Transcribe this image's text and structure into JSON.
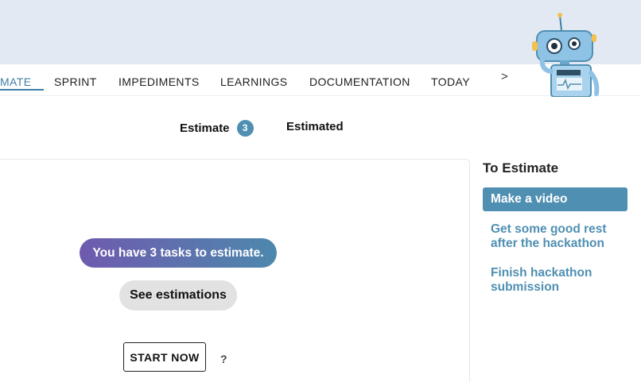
{
  "nav": {
    "items": [
      "MATE",
      "SPRINT",
      "IMPEDIMENTS",
      "LEARNINGS",
      "DOCUMENTATION",
      "TODAY"
    ],
    "active_index": 0,
    "next_glyph": ">"
  },
  "tabs": {
    "estimate_label": "Estimate",
    "estimate_count": "3",
    "estimated_label": "Estimated"
  },
  "main": {
    "info_text": "You have 3 tasks to estimate.",
    "see_button": "See estimations",
    "start_button": "START NOW",
    "help_glyph": "?"
  },
  "sidebar": {
    "title": "To Estimate",
    "items": [
      "Make a video",
      "Get some good rest after the hackathon",
      "Finish hackathon submission"
    ],
    "selected_index": 0
  },
  "colors": {
    "accent": "#4f8fb2",
    "header_bg": "#e3e9f2",
    "gradient_start": "#6f5aae",
    "gradient_end": "#4d88ad"
  },
  "icons": {
    "mascot": "robot-mascot-icon",
    "next": "chevron-right-icon"
  }
}
